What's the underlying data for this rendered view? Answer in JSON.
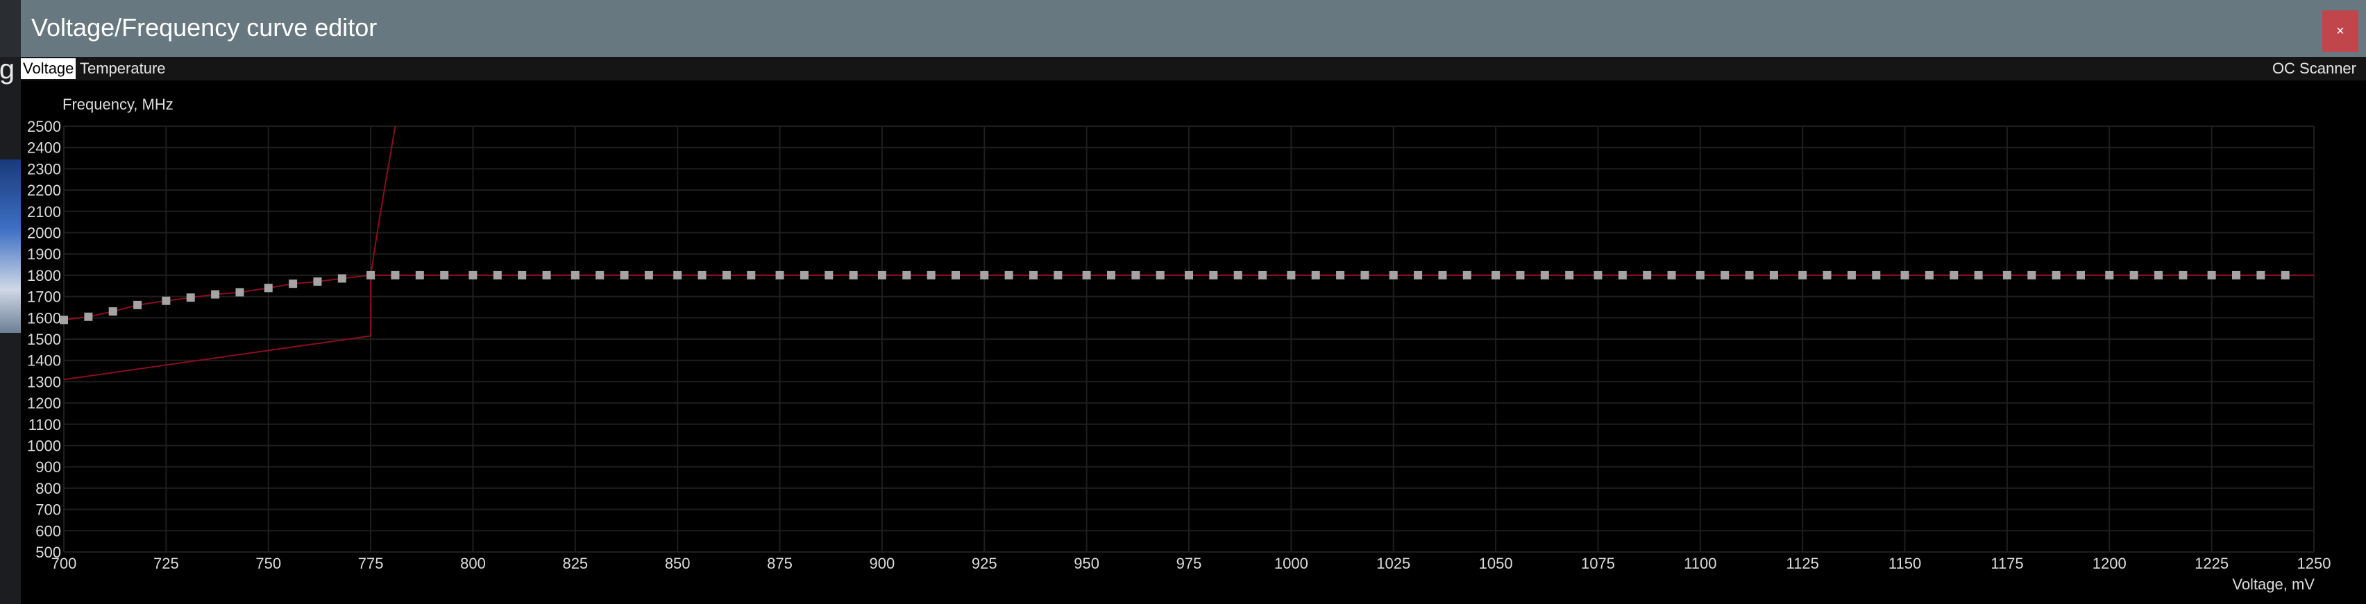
{
  "window": {
    "title": "Voltage/Frequency curve editor",
    "close_label": "×"
  },
  "tabs": [
    {
      "label": "Voltage",
      "active": true
    },
    {
      "label": "Temperature",
      "active": false
    }
  ],
  "oc_scanner_label": "OC Scanner",
  "background_peek_text": "ig",
  "colors": {
    "titlebar": "#687880",
    "close_button": "#c0464c",
    "grid": "#1e1e1e",
    "curve": "#8a0e1e",
    "point": "#a4a4a4",
    "axis_text": "#dcdcdc"
  },
  "chart_data": {
    "type": "scatter",
    "title": "",
    "ylabel": "Frequency, MHz",
    "xlabel": "Voltage, mV",
    "xlim": [
      700,
      1250
    ],
    "ylim": [
      500,
      2500
    ],
    "grid": true,
    "x_ticks": [
      700,
      725,
      750,
      775,
      800,
      825,
      850,
      875,
      900,
      925,
      950,
      975,
      1000,
      1025,
      1050,
      1075,
      1100,
      1125,
      1150,
      1175,
      1200,
      1225,
      1250
    ],
    "y_ticks": [
      500,
      600,
      700,
      800,
      900,
      1000,
      1100,
      1200,
      1300,
      1400,
      1500,
      1600,
      1700,
      1800,
      1900,
      2000,
      2100,
      2200,
      2300,
      2400,
      2500
    ],
    "points": {
      "x": [
        700,
        706,
        712,
        718,
        725,
        731,
        737,
        743,
        750,
        756,
        762,
        768,
        775,
        781,
        787,
        793,
        800,
        806,
        812,
        818,
        825,
        831,
        837,
        843,
        850,
        856,
        862,
        868,
        875,
        881,
        887,
        893,
        900,
        906,
        912,
        918,
        925,
        931,
        937,
        943,
        950,
        956,
        962,
        968,
        975,
        981,
        987,
        993,
        1000,
        1006,
        1012,
        1018,
        1025,
        1031,
        1037,
        1043,
        1050,
        1056,
        1062,
        1068,
        1075,
        1081,
        1087,
        1093,
        1100,
        1106,
        1112,
        1118,
        1125,
        1131,
        1137,
        1143,
        1150,
        1156,
        1162,
        1168,
        1175,
        1181,
        1187,
        1193,
        1200,
        1206,
        1212,
        1218,
        1225,
        1231,
        1237,
        1243
      ],
      "y": [
        1590,
        1605,
        1630,
        1660,
        1680,
        1695,
        1710,
        1720,
        1740,
        1760,
        1770,
        1785,
        1800,
        1800,
        1800,
        1800,
        1800,
        1800,
        1800,
        1800,
        1800,
        1800,
        1800,
        1800,
        1800,
        1800,
        1800,
        1800,
        1800,
        1800,
        1800,
        1800,
        1800,
        1800,
        1800,
        1800,
        1800,
        1800,
        1800,
        1800,
        1800,
        1800,
        1800,
        1800,
        1800,
        1800,
        1800,
        1800,
        1800,
        1800,
        1800,
        1800,
        1800,
        1800,
        1800,
        1800,
        1800,
        1800,
        1800,
        1800,
        1800,
        1800,
        1800,
        1800,
        1800,
        1800,
        1800,
        1800,
        1800,
        1800,
        1800,
        1800,
        1800,
        1800,
        1800,
        1800,
        1800,
        1800,
        1800,
        1800,
        1800,
        1800,
        1800,
        1800,
        1800,
        1800,
        1800,
        1800
      ]
    },
    "offset_curve": {
      "x": [
        700,
        775,
        775,
        777,
        781
      ],
      "y": [
        1310,
        1515,
        1800,
        2050,
        2500
      ]
    },
    "flat_line": {
      "x": [
        775,
        1250
      ],
      "y": [
        1800,
        1800
      ]
    }
  }
}
